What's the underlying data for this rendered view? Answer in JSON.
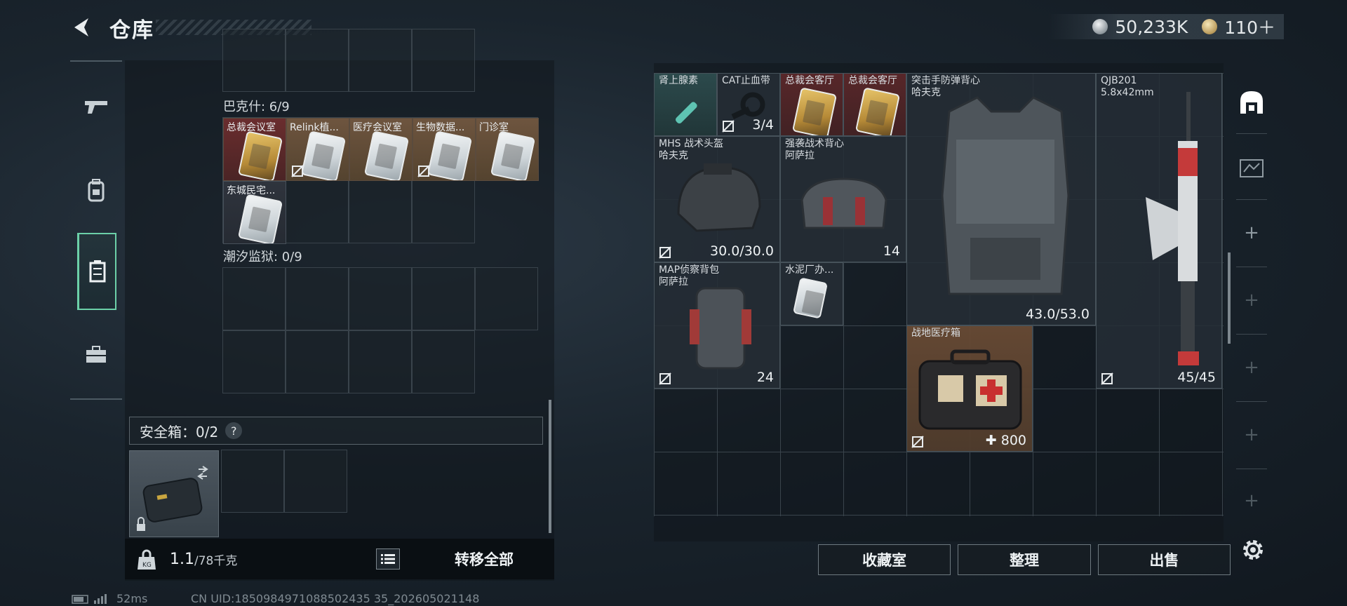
{
  "header": {
    "title": "仓库"
  },
  "currency": {
    "silver": "50,233K",
    "gold": "110＋"
  },
  "left_nav": {
    "items": [
      "gun-icon",
      "backpack-icon",
      "container-icon",
      "toolbox-icon"
    ],
    "active": 2
  },
  "left": {
    "bakeshi": {
      "label": "巴克什: 6/9",
      "items": [
        {
          "label": "总裁会议室",
          "style": "red"
        },
        {
          "label": "Relink植...",
          "style": "orange"
        },
        {
          "label": "医疗会议室",
          "style": "orange"
        },
        {
          "label": "生物数据...",
          "style": "orange"
        },
        {
          "label": "门诊室",
          "style": "orange"
        },
        {
          "label": "东城民宅...",
          "style": "dark"
        }
      ]
    },
    "chaoxi": {
      "label": "潮汐监狱: 0/9"
    },
    "safe": {
      "label": "安全箱：0/2",
      "help": "?"
    },
    "footer": {
      "weight": "1.1",
      "weight_max": "/78千克",
      "transfer_all": "转移全部"
    }
  },
  "right": {
    "items": [
      {
        "name": "肾上腺素",
        "value": ""
      },
      {
        "name": "CAT止血带",
        "value": "3/4"
      },
      {
        "name": "总裁会客厅",
        "value": ""
      },
      {
        "name": "总裁会客厅",
        "value": ""
      },
      {
        "name": "突击手防弹背心",
        "sub": "哈夫克",
        "value": "43.0/53.0"
      },
      {
        "name": "QJB201",
        "sub": "5.8x42mm",
        "value": "45/45"
      },
      {
        "name": "MHS 战术头盔",
        "sub": "哈夫克",
        "value": "30.0/30.0"
      },
      {
        "name": "强袭战术背心",
        "sub": "阿萨拉",
        "value": "14"
      },
      {
        "name": "MAP侦察背包",
        "sub": "阿萨拉",
        "value": "24"
      },
      {
        "name": "水泥厂办...",
        "value": ""
      },
      {
        "name": "战地医疗箱",
        "value": "800"
      }
    ]
  },
  "bottom_buttons": {
    "collection": "收藏室",
    "sort": "整理",
    "sell": "出售"
  },
  "status": {
    "ping": "52ms",
    "uid": "CN UID:1850984971088502435 35_202605021148"
  }
}
